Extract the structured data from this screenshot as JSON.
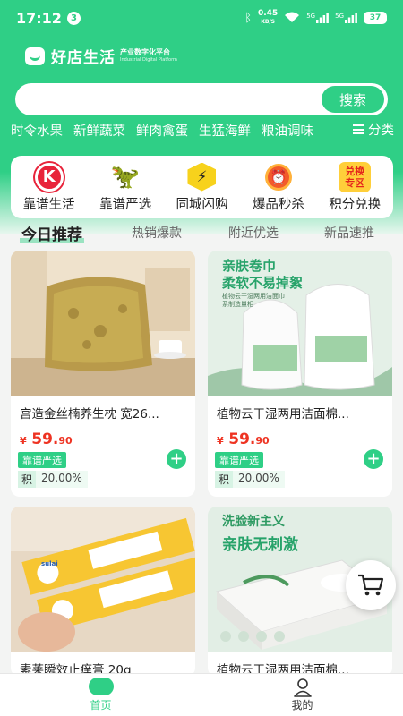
{
  "status_bar": {
    "time": "17:12",
    "notif_count": "3",
    "net_speed_value": "0.45",
    "net_speed_unit": "KB/S",
    "signal1": "5G",
    "signal2": "5G",
    "battery": "37"
  },
  "header": {
    "app_name": "好店生活",
    "tagline": "产业数字化平台",
    "tagline_en": "Industrial Digital Platform"
  },
  "search": {
    "placeholder": "",
    "button_label": "搜索"
  },
  "categories": {
    "items": [
      "时令水果",
      "新鲜蔬菜",
      "鲜肉禽蛋",
      "生猛海鲜",
      "粮油调味"
    ],
    "more_label": "分类"
  },
  "quick_access": [
    {
      "label": "靠谱生活",
      "icon": "k-logo-icon",
      "glyph": "K"
    },
    {
      "label": "靠谱严选",
      "icon": "dinosaur-icon",
      "glyph": "🦖"
    },
    {
      "label": "同城闪购",
      "icon": "lightning-icon",
      "glyph": "⚡"
    },
    {
      "label": "爆品秒杀",
      "icon": "alarm-clock-icon",
      "glyph": "⏰"
    },
    {
      "label": "积分兑换",
      "icon": "points-exchange-icon",
      "glyph1": "兑换",
      "glyph2": "专区"
    }
  ],
  "tabs": [
    "今日推荐",
    "热销爆款",
    "附近优选",
    "新品速推"
  ],
  "products": [
    {
      "name": "宫造金丝楠养生枕 宽26...",
      "price_symbol": "¥",
      "price_int": "59.",
      "price_dec": "90",
      "tag": "靠谱严选",
      "ratio_key": "积",
      "ratio_value": "20.00%"
    },
    {
      "name": "植物云干湿两用洁面棉...",
      "price_symbol": "¥",
      "price_int": "59.",
      "price_dec": "90",
      "tag": "靠谱严选",
      "ratio_key": "积",
      "ratio_value": "20.00%",
      "image_text1": "亲肤卷巾",
      "image_text2": "柔软不易掉絮",
      "image_text3": "植物云干湿两用洁面巾",
      "image_text4": "系制造量相"
    },
    {
      "name": "素莱瞬效止痒膏 20g",
      "brand": "sulai"
    },
    {
      "name": "植物云干湿两用洁面棉...",
      "image_text1": "洗脸新主义",
      "image_text2": "亲肤无刺激"
    }
  ],
  "bottom_nav": [
    {
      "label": "首页",
      "active": true
    },
    {
      "label": "我的",
      "active": false
    }
  ],
  "colors": {
    "primary": "#2fcf86",
    "price": "#ee3322"
  }
}
